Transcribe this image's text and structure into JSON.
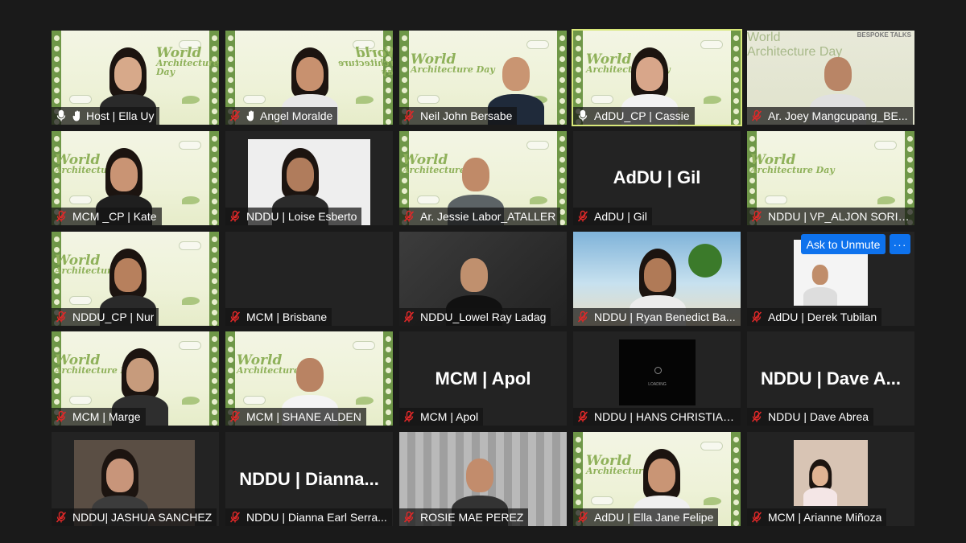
{
  "colors": {
    "background": "#1a1a1a",
    "tile": "#232323",
    "active_border": "#d8e87a",
    "button_blue": "#0e72ed",
    "mic_off_red": "#e02828"
  },
  "unmute_button": {
    "label": "Ask to Unmute",
    "more_label": "···"
  },
  "participants": [
    {
      "name": "Host | Ella Uy",
      "mic": "on",
      "role_icon": "raised-hand-icon",
      "bg": "wad"
    },
    {
      "name": "Angel Moralde",
      "mic": "off",
      "role_icon": "raised-hand-icon",
      "bg": "wad"
    },
    {
      "name": "Neil John Bersabe",
      "mic": "off",
      "bg": "wad"
    },
    {
      "name": "AdDU_CP | Cassie",
      "mic": "on",
      "active": true,
      "bg": "wad"
    },
    {
      "name": "Ar. Joey Mangcupang_BE...",
      "mic": "off",
      "bg": "talk",
      "logo": "BESPOKE TALKS"
    },
    {
      "name": "MCM _CP | Kate",
      "mic": "off",
      "bg": "wad"
    },
    {
      "name": "NDDU | Loise Esberto",
      "mic": "off",
      "bg": "dark"
    },
    {
      "name": "Ar. Jessie Labor_ATALLER",
      "mic": "off",
      "bg": "wad"
    },
    {
      "name": "AdDU | Gil",
      "mic": "off",
      "bg": "dark",
      "center_text": "AdDU | Gil"
    },
    {
      "name": "NDDU | VP_ALJON SORIL...",
      "mic": "off",
      "bg": "wad"
    },
    {
      "name": "NDDU_CP |  Nur",
      "mic": "off",
      "bg": "wad"
    },
    {
      "name": "MCM | Brisbane",
      "mic": "off",
      "bg": "dark"
    },
    {
      "name": "NDDU_Lowel Ray Ladag",
      "mic": "off",
      "bg": "room"
    },
    {
      "name": "NDDU | Ryan Benedict Ba...",
      "mic": "off",
      "bg": "beach"
    },
    {
      "name": "AdDU | Derek Tubilan",
      "mic": "off",
      "bg": "dark"
    },
    {
      "name": "MCM | Marge",
      "mic": "off",
      "bg": "wad"
    },
    {
      "name": "MCM | SHANE ALDEN",
      "mic": "off",
      "bg": "wad"
    },
    {
      "name": "MCM | Apol",
      "mic": "off",
      "bg": "dark",
      "center_text": "MCM | Apol"
    },
    {
      "name": "NDDU | HANS CHRISTIAN...",
      "mic": "off",
      "bg": "dark",
      "loading_text": "LOADING"
    },
    {
      "name": "NDDU | Dave Abrea",
      "mic": "off",
      "bg": "dark",
      "center_text": "NDDU | Dave A..."
    },
    {
      "name": "NDDU| JASHUA SANCHEZ",
      "mic": "off",
      "bg": "dark"
    },
    {
      "name": "NDDU | Dianna Earl Serra...",
      "mic": "off",
      "bg": "dark",
      "center_text": "NDDU | Dianna..."
    },
    {
      "name": "ROSIE MAE PEREZ",
      "mic": "off",
      "bg": "curtain"
    },
    {
      "name": "AdDU | Ella Jane Felipe",
      "mic": "off",
      "bg": "wad"
    },
    {
      "name": "MCM | Arianne Miñoza",
      "mic": "off",
      "bg": "dark"
    }
  ],
  "wad_background": {
    "line1": "World",
    "line2": "Architecture Day"
  }
}
